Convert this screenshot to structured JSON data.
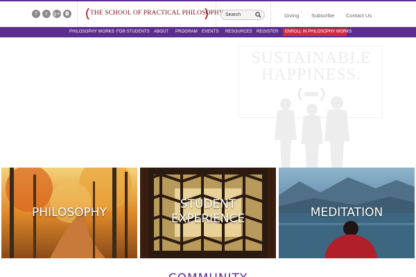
{
  "header": {
    "social": [
      {
        "name": "facebook-icon",
        "glyph": "f"
      },
      {
        "name": "twitter-icon",
        "glyph": "t"
      },
      {
        "name": "google-plus-icon",
        "glyph": "g+"
      },
      {
        "name": "instagram-icon",
        "glyph": "◘"
      }
    ],
    "logo_text": "THE SCHOOL OF PRACTICAL PHILOSOPHY",
    "search_placeholder": "Search",
    "utility_links": [
      "Giving",
      "Subscribe",
      "Contact Us"
    ]
  },
  "nav": {
    "items": [
      "PHILOSOPHY WORKS",
      "FOR STUDENTS",
      "ABOUT",
      "PROGRAM",
      "EVENTS",
      "RESOURCES",
      "REGISTER"
    ],
    "enroll_label": "ENROLL IN PHILOSOPHY WORKS"
  },
  "hero": {
    "poster_line1": "SUSTAINABLE",
    "poster_line2": "HAPPINESS."
  },
  "tiles": [
    {
      "label_lines": [
        "PHILOSOPHY"
      ]
    },
    {
      "label_lines": [
        "STUDENT",
        "EXPERIENCE"
      ]
    },
    {
      "label_lines": [
        "MEDITATION"
      ]
    }
  ],
  "section_heading": "COMMUNITY",
  "colors": {
    "brand_purple": "#5b2d8e",
    "enroll_red": "#d12a3a",
    "logo_maroon": "#7a1422"
  }
}
